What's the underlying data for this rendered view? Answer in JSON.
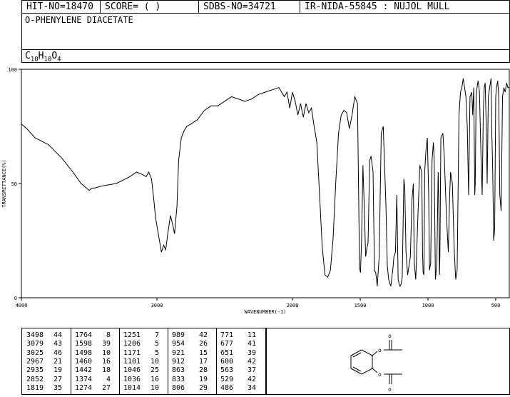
{
  "header": {
    "hit_no": "HIT-NO=18470",
    "score": "SCORE=  (   )",
    "sdbs_no": "SDBS-NO=34721",
    "ir_id": "IR-NIDA-55845 : NUJOL MULL"
  },
  "compound": {
    "name": "O-PHENYLENE DIACETATE",
    "formula_parts": [
      {
        "t": "C",
        "sub": false
      },
      {
        "t": "10",
        "sub": true
      },
      {
        "t": "H",
        "sub": false
      },
      {
        "t": "10",
        "sub": true
      },
      {
        "t": "O",
        "sub": false
      },
      {
        "t": "4",
        "sub": true
      }
    ]
  },
  "chart_data": {
    "type": "line",
    "xlabel": "WAVENUMBER(-1)",
    "ylabel": "TRANSMITTANCE(%)",
    "xlim": [
      4000,
      400
    ],
    "ylim": [
      0,
      100
    ],
    "x_ticks": [
      4000,
      3000,
      2000,
      1500,
      1000,
      500
    ],
    "y_ticks": [
      0,
      50,
      100
    ],
    "grid": false,
    "x": [
      4000,
      3960,
      3900,
      3800,
      3700,
      3620,
      3560,
      3500,
      3480,
      3460,
      3400,
      3300,
      3200,
      3150,
      3110,
      3079,
      3060,
      3040,
      3025,
      3010,
      2990,
      2967,
      2950,
      2935,
      2920,
      2900,
      2880,
      2870,
      2852,
      2840,
      2820,
      2800,
      2780,
      2750,
      2700,
      2650,
      2600,
      2550,
      2500,
      2450,
      2400,
      2350,
      2300,
      2250,
      2200,
      2150,
      2100,
      2060,
      2040,
      2020,
      2000,
      1980,
      1960,
      1940,
      1920,
      1900,
      1880,
      1860,
      1840,
      1820,
      1800,
      1780,
      1760,
      1740,
      1720,
      1700,
      1680,
      1660,
      1640,
      1620,
      1600,
      1580,
      1560,
      1540,
      1520,
      1505,
      1498,
      1490,
      1480,
      1470,
      1460,
      1450,
      1442,
      1430,
      1420,
      1405,
      1395,
      1385,
      1374,
      1360,
      1345,
      1330,
      1310,
      1300,
      1290,
      1274,
      1260,
      1251,
      1240,
      1230,
      1220,
      1212,
      1206,
      1198,
      1190,
      1178,
      1171,
      1162,
      1150,
      1130,
      1118,
      1108,
      1101,
      1090,
      1075,
      1060,
      1046,
      1040,
      1036,
      1030,
      1024,
      1014,
      1005,
      995,
      989,
      980,
      970,
      960,
      954,
      945,
      935,
      925,
      921,
      915,
      912,
      905,
      890,
      880,
      863,
      850,
      840,
      833,
      820,
      806,
      795,
      785,
      771,
      760,
      750,
      740,
      730,
      720,
      710,
      700,
      690,
      677,
      670,
      662,
      655,
      651,
      645,
      638,
      630,
      620,
      608,
      600,
      592,
      585,
      578,
      570,
      563,
      555,
      545,
      535,
      529,
      522,
      515,
      508,
      500,
      494,
      486,
      478,
      470,
      460,
      450,
      440,
      430,
      420,
      410,
      400
    ],
    "y": [
      76,
      74,
      70,
      67,
      61,
      55,
      50,
      47,
      48,
      48,
      49,
      50,
      53,
      55,
      54,
      53,
      55,
      52,
      44,
      35,
      28,
      20,
      23,
      21,
      28,
      36,
      31,
      28,
      40,
      60,
      70,
      73,
      75,
      76,
      78,
      82,
      84,
      84,
      86,
      88,
      87,
      86,
      87,
      89,
      90,
      91,
      92,
      88,
      90,
      83,
      90,
      86,
      80,
      85,
      79,
      85,
      81,
      83,
      75,
      68,
      45,
      22,
      10,
      9,
      12,
      26,
      51,
      72,
      80,
      82,
      81,
      74,
      80,
      88,
      85,
      13,
      11,
      25,
      58,
      40,
      18,
      22,
      24,
      60,
      62,
      55,
      12,
      11,
      5,
      18,
      72,
      75,
      40,
      14,
      8,
      5,
      12,
      18,
      20,
      45,
      8,
      6,
      5,
      6,
      9,
      52,
      48,
      20,
      10,
      18,
      43,
      50,
      15,
      8,
      35,
      58,
      55,
      20,
      11,
      10,
      55,
      65,
      70,
      45,
      12,
      15,
      60,
      68,
      60,
      8,
      15,
      55,
      45,
      10,
      18,
      70,
      72,
      62,
      35,
      20,
      45,
      55,
      50,
      20,
      8,
      12,
      80,
      90,
      92,
      96,
      92,
      88,
      75,
      45,
      88,
      90,
      80,
      92,
      45,
      50,
      88,
      92,
      95,
      90,
      60,
      45,
      80,
      92,
      94,
      75,
      50,
      88,
      92,
      96,
      72,
      55,
      25,
      30,
      88,
      92,
      95,
      88,
      45,
      38,
      88,
      92,
      90,
      94,
      92,
      92
    ],
    "peak_table": [
      {
        "wn": 3498,
        "t": 44
      },
      {
        "wn": 3079,
        "t": 43
      },
      {
        "wn": 3025,
        "t": 46
      },
      {
        "wn": 2967,
        "t": 21
      },
      {
        "wn": 2935,
        "t": 19
      },
      {
        "wn": 2852,
        "t": 27
      },
      {
        "wn": 1819,
        "t": 35
      },
      {
        "wn": 1764,
        "t": 8
      },
      {
        "wn": 1598,
        "t": 39
      },
      {
        "wn": 1498,
        "t": 10
      },
      {
        "wn": 1460,
        "t": 16
      },
      {
        "wn": 1442,
        "t": 18
      },
      {
        "wn": 1374,
        "t": 4
      },
      {
        "wn": 1274,
        "t": 27
      },
      {
        "wn": 1251,
        "t": 7
      },
      {
        "wn": 1206,
        "t": 5
      },
      {
        "wn": 1171,
        "t": 5
      },
      {
        "wn": 1101,
        "t": 10
      },
      {
        "wn": 1046,
        "t": 25
      },
      {
        "wn": 1036,
        "t": 16
      },
      {
        "wn": 1014,
        "t": 10
      },
      {
        "wn": 989,
        "t": 42
      },
      {
        "wn": 954,
        "t": 26
      },
      {
        "wn": 921,
        "t": 15
      },
      {
        "wn": 912,
        "t": 17
      },
      {
        "wn": 863,
        "t": 28
      },
      {
        "wn": 833,
        "t": 19
      },
      {
        "wn": 806,
        "t": 29
      },
      {
        "wn": 771,
        "t": 11
      },
      {
        "wn": 677,
        "t": 41
      },
      {
        "wn": 651,
        "t": 39
      },
      {
        "wn": 600,
        "t": 42
      },
      {
        "wn": 563,
        "t": 37
      },
      {
        "wn": 529,
        "t": 42
      },
      {
        "wn": 486,
        "t": 34
      }
    ]
  }
}
